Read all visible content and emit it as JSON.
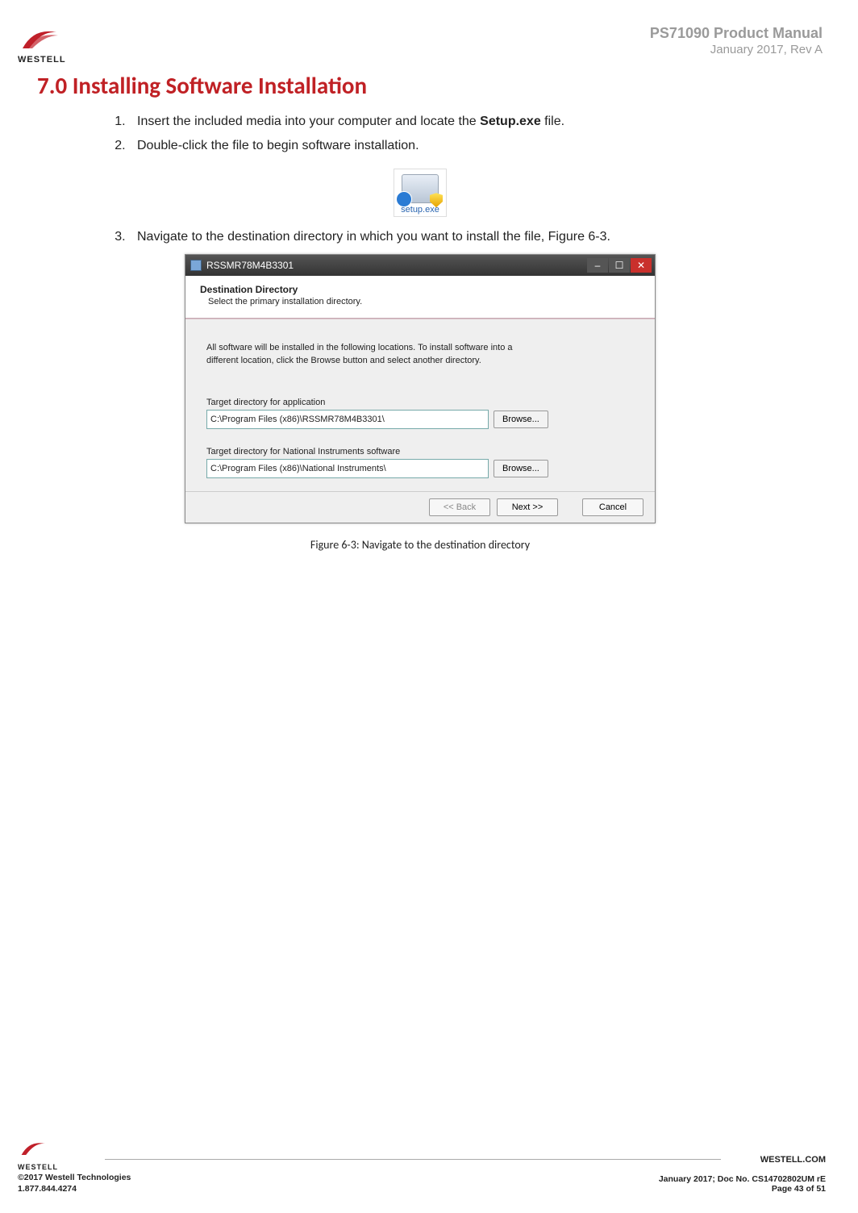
{
  "header": {
    "brand": "WESTELL",
    "title1": "PS71090 Product Manual",
    "title2": "January 2017, Rev A"
  },
  "section": {
    "heading": "7.0 Installing Software Installation",
    "step1_pre": "Insert the included media into your computer and locate the ",
    "step1_bold": "Setup.exe",
    "step1_post": " file.",
    "step2": "Double-click the file to begin software installation.",
    "step3": "Navigate to the destination directory in which you want to install the file, Figure 6-3.",
    "setup_label": "setup.exe"
  },
  "dialog": {
    "title": "RSSMR78M4B3301",
    "hdr_title": "Destination Directory",
    "hdr_sub": "Select the primary installation directory.",
    "body_p1": "All software will be installed in the following locations. To install software into a",
    "body_p2": "different location, click the Browse button and select another directory.",
    "field1_lbl": "Target directory for application",
    "field1_val": "C:\\Program Files (x86)\\RSSMR78M4B3301\\",
    "field2_lbl": "Target directory for National Instruments software",
    "field2_val": "C:\\Program Files (x86)\\National Instruments\\",
    "browse": "Browse...",
    "back": "<< Back",
    "next": "Next >>",
    "cancel": "Cancel",
    "min": "–",
    "max": "☐",
    "close": "✕"
  },
  "caption": "Figure 6-3: Navigate to the destination directory",
  "footer": {
    "brand": "WESTELL",
    "copyright": "©2017 Westell Technologies",
    "phone": "1.877.844.4274",
    "site": "WESTELL.COM",
    "docno": "January 2017; Doc No. CS14702802UM rE",
    "pageno": "Page 43 of 51"
  }
}
